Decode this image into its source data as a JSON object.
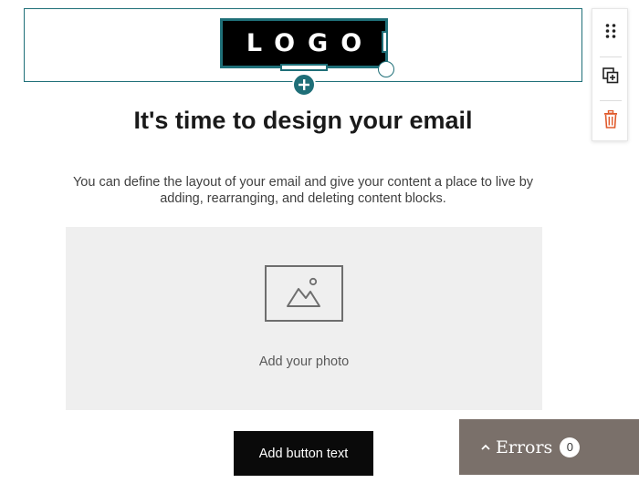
{
  "logo": {
    "text": "LOGO"
  },
  "toolbar": {
    "drag_icon": "drag-handle-icon",
    "duplicate_icon": "duplicate-icon",
    "delete_icon": "trash-icon"
  },
  "content": {
    "headline": "It's time to design your email",
    "intro": "You can define the layout of your email and give your content a place to live by adding, rearranging, and deleting content blocks.",
    "photo_label": "Add your photo",
    "button_label": "Add button text"
  },
  "errors": {
    "label": "Errors",
    "count": "0"
  },
  "colors": {
    "selection_accent": "#1f6f78",
    "delete_accent": "#e05a2b",
    "errors_panel": "#7a706a",
    "photo_placeholder": "#efefef"
  }
}
